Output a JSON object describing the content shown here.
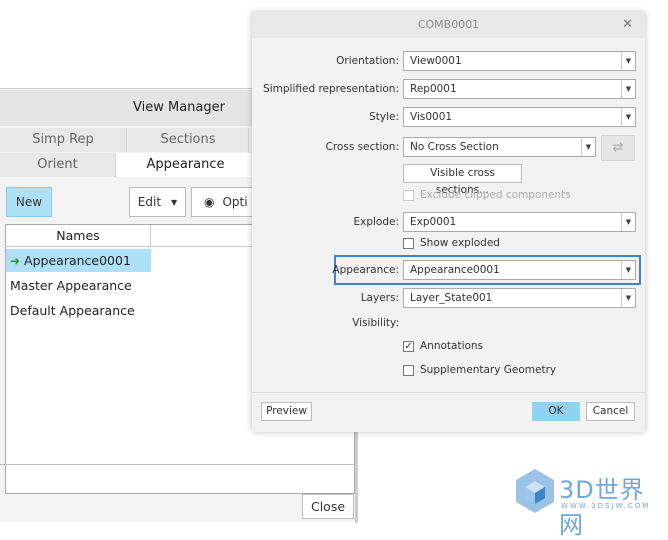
{
  "view_manager": {
    "title": "View Manager",
    "tabs_row1": [
      "Simp Rep",
      "Sections"
    ],
    "tabs_row2": [
      "Orient",
      "Appearance"
    ],
    "active_tab": "Appearance",
    "toolbar": {
      "new": "New",
      "edit": "Edit",
      "options": "Opti"
    },
    "list": {
      "header": "Names",
      "items": [
        "Appearance0001",
        "Master Appearance",
        "Default Appearance"
      ],
      "selected": "Appearance0001"
    },
    "close": "Close"
  },
  "dialog": {
    "title": "COMB0001",
    "fields": {
      "orientation": {
        "label": "Orientation:",
        "value": "View0001"
      },
      "simp_rep": {
        "label": "Simplified representation:",
        "value": "Rep0001"
      },
      "style": {
        "label": "Style:",
        "value": "Vis0001"
      },
      "cross_section": {
        "label": "Cross section:",
        "value": "No Cross Section"
      },
      "explode": {
        "label": "Explode:",
        "value": "Exp0001"
      },
      "appearance": {
        "label": "Appearance:",
        "value": "Appearance0001"
      },
      "layers": {
        "label": "Layers:",
        "value": "Layer_State001"
      },
      "visibility": {
        "label": "Visibility:"
      }
    },
    "visible_cross_sections": "Visible cross sections...",
    "exclude_clipped": {
      "label": "Exclude clipped components",
      "checked": false,
      "disabled": true
    },
    "show_exploded": {
      "label": "Show exploded",
      "checked": false
    },
    "annotations": {
      "label": "Annotations",
      "checked": true
    },
    "supplementary": {
      "label": "Supplementary Geometry",
      "checked": false
    },
    "preview": "Preview",
    "ok": "OK",
    "cancel": "Cancel",
    "highlight_color": "#3d85c6",
    "ok_color": "#8fd3f3"
  },
  "watermark": {
    "text": "3D世界网",
    "url_text": "WWW.3DSJW.COM"
  }
}
